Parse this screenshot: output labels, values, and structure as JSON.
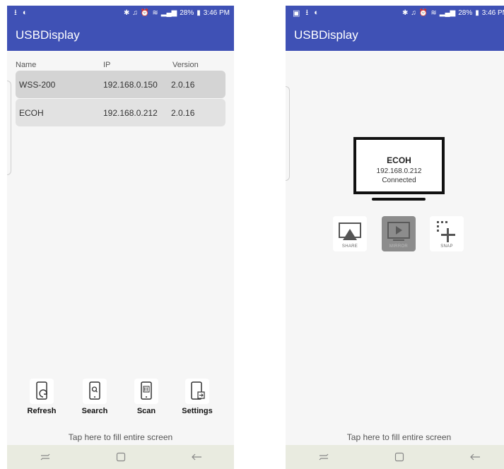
{
  "status_bar": {
    "battery": "28%",
    "time": "3:46 PM"
  },
  "left_screen": {
    "app_title": "USBDisplay",
    "columns": {
      "name": "Name",
      "ip": "IP",
      "version": "Version"
    },
    "devices": [
      {
        "name": "WSS-200",
        "ip": "192.168.0.150",
        "version": "2.0.16",
        "selected": true
      },
      {
        "name": "ECOH",
        "ip": "192.168.0.212",
        "version": "2.0.16",
        "selected": false
      }
    ],
    "toolbar": {
      "refresh": "Refresh",
      "search": "Search",
      "scan": "Scan",
      "settings": "Settings"
    },
    "tap_hint": "Tap here to fill entire screen"
  },
  "right_screen": {
    "app_title": "USBDisplay",
    "connected_device": {
      "name": "ECOH",
      "ip": "192.168.0.212",
      "status": "Connected"
    },
    "modes": {
      "share": "SHARE",
      "mirror": "MIRROR",
      "snap": "SNAP"
    },
    "active_mode": "mirror",
    "tap_hint": "Tap here to fill entire screen"
  },
  "colors": {
    "app_bar": "#3f51b5",
    "background": "#f6f6f6",
    "nav_bar": "#e9ebe0",
    "selected_row": "#d4d4d4",
    "row": "#e2e2e2"
  },
  "icons": [
    "usb-icon",
    "data-saver-icon",
    "bluetooth-icon",
    "mute-icon",
    "alarm-icon",
    "wifi-icon",
    "signal-icon",
    "battery-icon",
    "recents-icon",
    "home-icon",
    "back-icon",
    "refresh-icon",
    "search-icon",
    "scan-icon",
    "settings-icon",
    "share-icon",
    "mirror-icon",
    "snap-icon",
    "monitor-icon"
  ]
}
